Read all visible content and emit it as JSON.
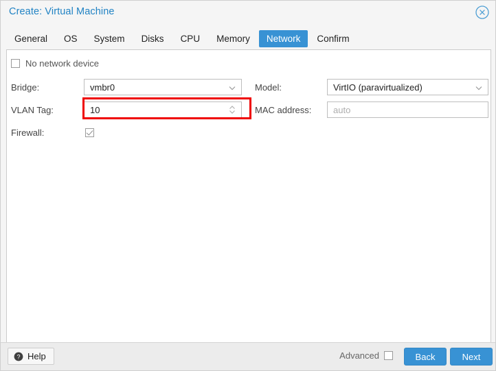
{
  "window": {
    "title": "Create: Virtual Machine",
    "close_icon": "close-circle-icon",
    "accent_color": "#3892d4",
    "title_color": "#2183c4",
    "highlight_color": "#ef0000"
  },
  "tabs": [
    {
      "label": "General",
      "active": false
    },
    {
      "label": "OS",
      "active": false
    },
    {
      "label": "System",
      "active": false
    },
    {
      "label": "Disks",
      "active": false
    },
    {
      "label": "CPU",
      "active": false
    },
    {
      "label": "Memory",
      "active": false
    },
    {
      "label": "Network",
      "active": true
    },
    {
      "label": "Confirm",
      "active": false
    }
  ],
  "form": {
    "no_network_device": {
      "label": "No network device",
      "checked": false
    },
    "left": {
      "bridge": {
        "label": "Bridge:",
        "value": "vmbr0",
        "icon": "chevron-down-icon"
      },
      "vlan_tag": {
        "label": "VLAN Tag:",
        "value": "10",
        "icon": "spinner-updown-icon",
        "highlighted": true
      },
      "firewall": {
        "label": "Firewall:",
        "checked": true
      }
    },
    "right": {
      "model": {
        "label": "Model:",
        "value": "VirtIO (paravirtualized)",
        "icon": "chevron-down-icon"
      },
      "mac_address": {
        "label": "MAC address:",
        "value": "",
        "placeholder": "auto"
      }
    }
  },
  "footer": {
    "help_label": "Help",
    "help_icon": "question-mark-circle-icon",
    "advanced_label": "Advanced",
    "advanced_checked": false,
    "back_label": "Back",
    "next_label": "Next"
  }
}
